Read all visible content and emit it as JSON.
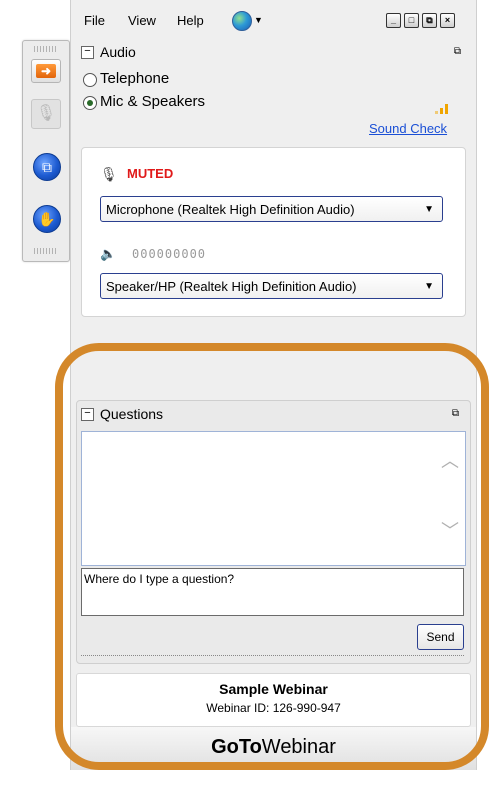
{
  "menu": {
    "file": "File",
    "view": "View",
    "help": "Help"
  },
  "window_controls": {
    "minimize": "_",
    "restore": "□",
    "popout": "⧉",
    "close": "×"
  },
  "audio_panel": {
    "title": "Audio",
    "options": [
      {
        "label": "Telephone",
        "selected": false
      },
      {
        "label": "Mic & Speakers",
        "selected": true
      }
    ],
    "sound_check_link": "Sound Check",
    "mic_status": "MUTED",
    "microphone_device": "Microphone (Realtek High Definition Audio)",
    "speaker_level_readout": "000000000",
    "speaker_device": "Speaker/HP (Realtek High Definition Audio)"
  },
  "questions_panel": {
    "title": "Questions",
    "input_value": "Where do I type a question?",
    "send_label": "Send"
  },
  "webinar": {
    "name": "Sample Webinar",
    "id_line": "Webinar ID: 126-990-947"
  },
  "brand": {
    "bold": "GoTo",
    "regular": "Webinar"
  },
  "colors": {
    "highlight": "#d4882a",
    "muted": "#e01919",
    "link": "#1a4fd6",
    "accent_border": "#2a3f8f"
  }
}
